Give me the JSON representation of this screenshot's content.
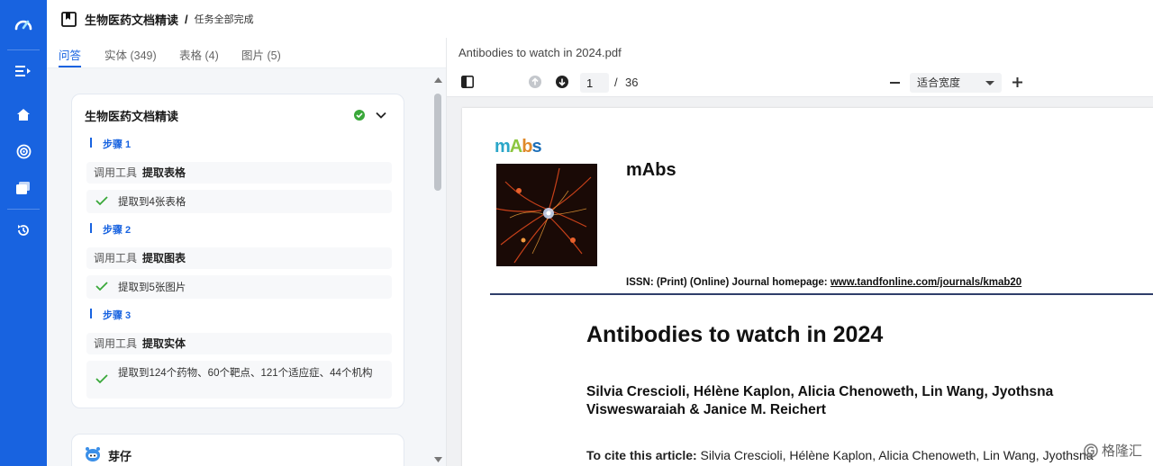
{
  "header": {
    "title": "生物医药文档精读",
    "separator": "/",
    "status": "任务全部完成"
  },
  "tabs": [
    {
      "label": "问答",
      "active": true
    },
    {
      "label": "实体 (349)",
      "active": false
    },
    {
      "label": "表格 (4)",
      "active": false
    },
    {
      "label": "图片 (5)",
      "active": false
    }
  ],
  "task_card": {
    "title": "生物医药文档精读",
    "steps": [
      {
        "label": "步骤 1",
        "tool_prefix": "调用工具",
        "tool_name": "提取表格",
        "result": "提取到4张表格"
      },
      {
        "label": "步骤 2",
        "tool_prefix": "调用工具",
        "tool_name": "提取图表",
        "result": "提取到5张图片"
      },
      {
        "label": "步骤 3",
        "tool_prefix": "调用工具",
        "tool_name": "提取实体",
        "result": "提取到124个药物、60个靶点、121个适应症、44个机构"
      }
    ]
  },
  "agent_card": {
    "title": "芽仔"
  },
  "pdf": {
    "file_name": "Antibodies to watch in 2024.pdf",
    "page_current": "1",
    "page_sep": "/",
    "page_total": "36",
    "zoom": "适合宽度",
    "journal_logo": {
      "m": "m",
      "a": "A",
      "b": "b",
      "s": "s"
    },
    "journal_name": "mAbs",
    "issn_prefix": "ISSN: (Print) (Online) Journal homepage: ",
    "issn_link": "www.tandfonline.com/journals/kmab20",
    "article_title": "Antibodies to watch in 2024",
    "authors": "Silvia Crescioli, Hélène Kaplon, Alicia Chenoweth, Lin Wang, Jyothsna Visweswaraiah & Janice M. Reichert",
    "cite_label": "To cite this article:",
    "cite_text": " Silvia Crescioli, Hélène Kaplon, Alicia Chenoweth, Lin Wang, Jyothsna"
  },
  "watermark": "格隆汇",
  "colors": {
    "accent": "#1863e0",
    "rail": "#1863e0",
    "success": "#3aa83a"
  }
}
